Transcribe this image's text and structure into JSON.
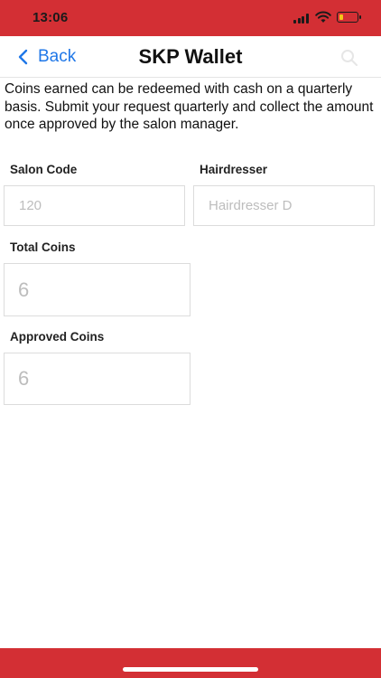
{
  "status_bar": {
    "time": "13:06",
    "icons": [
      "signal-icon",
      "wifi-icon",
      "battery-low-icon"
    ]
  },
  "nav": {
    "back_label": "Back",
    "title": "SKP Wallet",
    "search_icon": "search-icon"
  },
  "intro_text": "Coins earned can be redeemed with cash on a quarterly basis. Submit your request quarterly and collect the amount once approved by the salon manager.",
  "form": {
    "salon_code": {
      "label": "Salon Code",
      "value": "120"
    },
    "hairdresser": {
      "label": "Hairdresser",
      "value": "Hairdresser D"
    },
    "total_coins": {
      "label": "Total Coins",
      "value": "6"
    },
    "approved_coins": {
      "label": "Approved Coins",
      "value": "6"
    }
  },
  "colors": {
    "brand_red": "#d32f34",
    "link_blue": "#1f77e8",
    "placeholder_gray": "#bdbdbd"
  }
}
